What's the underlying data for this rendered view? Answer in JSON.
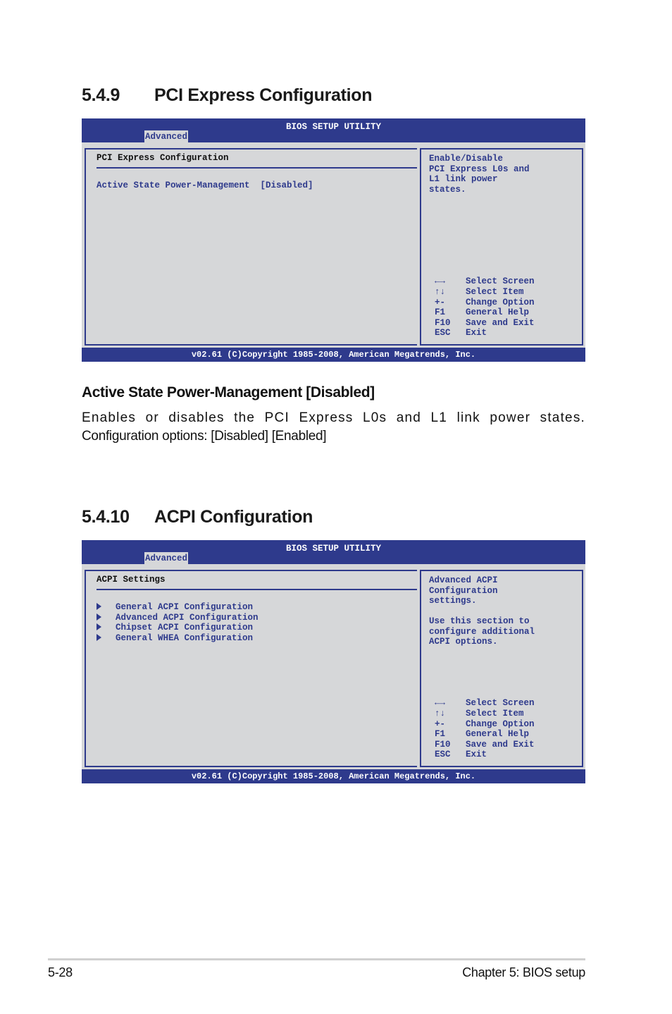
{
  "section1": {
    "number": "5.4.9",
    "title": "PCI Express Configuration",
    "bios": {
      "utility_title": "BIOS SETUP UTILITY",
      "active_tab": "Advanced",
      "section_title": "PCI Express Configuration",
      "items": [
        {
          "label": "Active State Power-Management",
          "value": "[Disabled]",
          "display": "Active State Power-Management  [Disabled]"
        }
      ],
      "help_text": "Enable/Disable\nPCI Express L0s and\nL1 link power\nstates.",
      "keys": [
        {
          "key": "←→",
          "action": "Select Screen"
        },
        {
          "key": "↑↓",
          "action": "Select Item"
        },
        {
          "key": "+-",
          "action": "Change Option"
        },
        {
          "key": "F1",
          "action": "General Help"
        },
        {
          "key": "F10",
          "action": "Save and Exit"
        },
        {
          "key": "ESC",
          "action": "Exit"
        }
      ],
      "copyright": "v02.61 (C)Copyright 1985-2008, American Megatrends, Inc."
    },
    "subheading": "Active State Power-Management [Disabled]",
    "description_line1": "Enables or disables the PCI Express L0s and L1 link power states.",
    "description_line2": "Configuration options: [Disabled] [Enabled]"
  },
  "section2": {
    "number": "5.4.10",
    "title": "ACPI Configuration",
    "bios": {
      "utility_title": "BIOS SETUP UTILITY",
      "active_tab": "Advanced",
      "section_title": "ACPI Settings",
      "items": [
        {
          "label": "General ACPI Configuration"
        },
        {
          "label": "Advanced ACPI Configuration"
        },
        {
          "label": "Chipset ACPI Configuration"
        },
        {
          "label": "General WHEA Configuration"
        }
      ],
      "help_text": "Advanced ACPI\nConfiguration\nsettings.\n\nUse this section to\nconfigure additional\nACPI options.",
      "keys": [
        {
          "key": "←→",
          "action": "Select Screen"
        },
        {
          "key": "↑↓",
          "action": "Select Item"
        },
        {
          "key": "+-",
          "action": "Change Option"
        },
        {
          "key": "F1",
          "action": "General Help"
        },
        {
          "key": "F10",
          "action": "Save and Exit"
        },
        {
          "key": "ESC",
          "action": "Exit"
        }
      ],
      "copyright": "v02.61 (C)Copyright 1985-2008, American Megatrends, Inc."
    }
  },
  "footer": {
    "page_number": "5-28",
    "chapter": "Chapter 5: BIOS setup"
  },
  "colors": {
    "bios_blue": "#2e3a8c",
    "bios_panel": "#d6d7d9"
  }
}
